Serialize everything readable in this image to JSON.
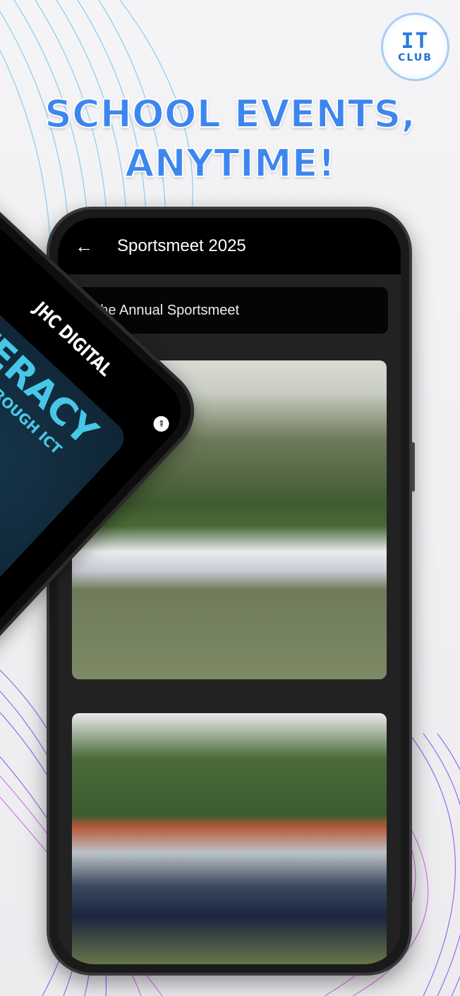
{
  "logo": {
    "it": "IT",
    "club": "CLUB"
  },
  "headline": {
    "line1": "SCHOOL EVENTS,",
    "line2": "ANYTIME!"
  },
  "app": {
    "title": "Sportsmeet 2025",
    "back_icon": "←",
    "description": "The Annual Sportsmeet"
  },
  "second_phone": {
    "title": "JHC DIGITAL",
    "banner_big": "LITERACY",
    "banner_sub": "LITERACY THROUGH ICT",
    "edit_icon": "✎"
  },
  "colors": {
    "accent": "#3d86f0",
    "purple": "#a040f0"
  }
}
